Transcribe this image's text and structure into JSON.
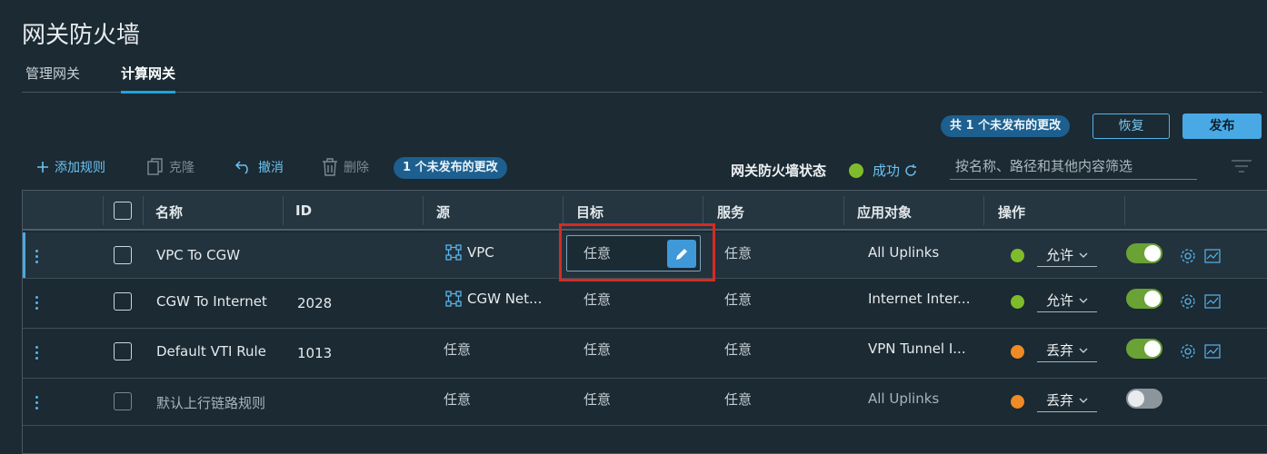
{
  "page": {
    "title": "网关防火墙"
  },
  "tabs": [
    {
      "label": "管理网关",
      "active": false
    },
    {
      "label": "计算网关",
      "active": true
    }
  ],
  "publish_bar": {
    "pending_badge": "共 1 个未发布的更改",
    "revert_label": "恢复",
    "publish_label": "发布"
  },
  "toolbar": {
    "add_rule": "添加规则",
    "clone": "克隆",
    "undo": "撤消",
    "delete": "删除",
    "unpublished_badge": "1 个未发布的更改",
    "status_label": "网关防火墙状态",
    "status_value": "成功",
    "filter_placeholder": "按名称、路径和其他内容筛选"
  },
  "table": {
    "columns": [
      "名称",
      "ID",
      "源",
      "目标",
      "服务",
      "应用对象",
      "操作"
    ],
    "rows": [
      {
        "name": "VPC To CGW",
        "id": "",
        "source": "VPC",
        "destination": "任意",
        "services": "任意",
        "applied_to": "All Uplinks",
        "action": "允许",
        "action_color": "green",
        "enabled": true,
        "selected": true,
        "editing_destination": true
      },
      {
        "name": "CGW To Internet",
        "id": "2028",
        "source": "CGW Net...",
        "destination": "任意",
        "services": "任意",
        "applied_to": "Internet Inter...",
        "action": "允许",
        "action_color": "green",
        "enabled": true
      },
      {
        "name": "Default VTI Rule",
        "id": "1013",
        "source": "任意",
        "destination": "任意",
        "services": "任意",
        "applied_to": "VPN Tunnel I...",
        "action": "丢弃",
        "action_color": "orange",
        "enabled": true
      },
      {
        "name": "默认上行链路规则",
        "id": "",
        "source": "任意",
        "destination": "任意",
        "services": "任意",
        "applied_to": "All Uplinks",
        "action": "丢弃",
        "action_color": "orange",
        "enabled": false
      }
    ]
  },
  "colors": {
    "accent": "#49a9e4",
    "success": "#7fbc2b",
    "drop": "#f08a24",
    "highlight": "#d42c22"
  },
  "icons": [
    "plus-icon",
    "clone-icon",
    "undo-icon",
    "trash-icon",
    "refresh-icon",
    "filter-icon",
    "group-icon",
    "pencil-icon",
    "gear-icon",
    "chart-icon",
    "chevron-down-icon",
    "kebab-icon"
  ]
}
